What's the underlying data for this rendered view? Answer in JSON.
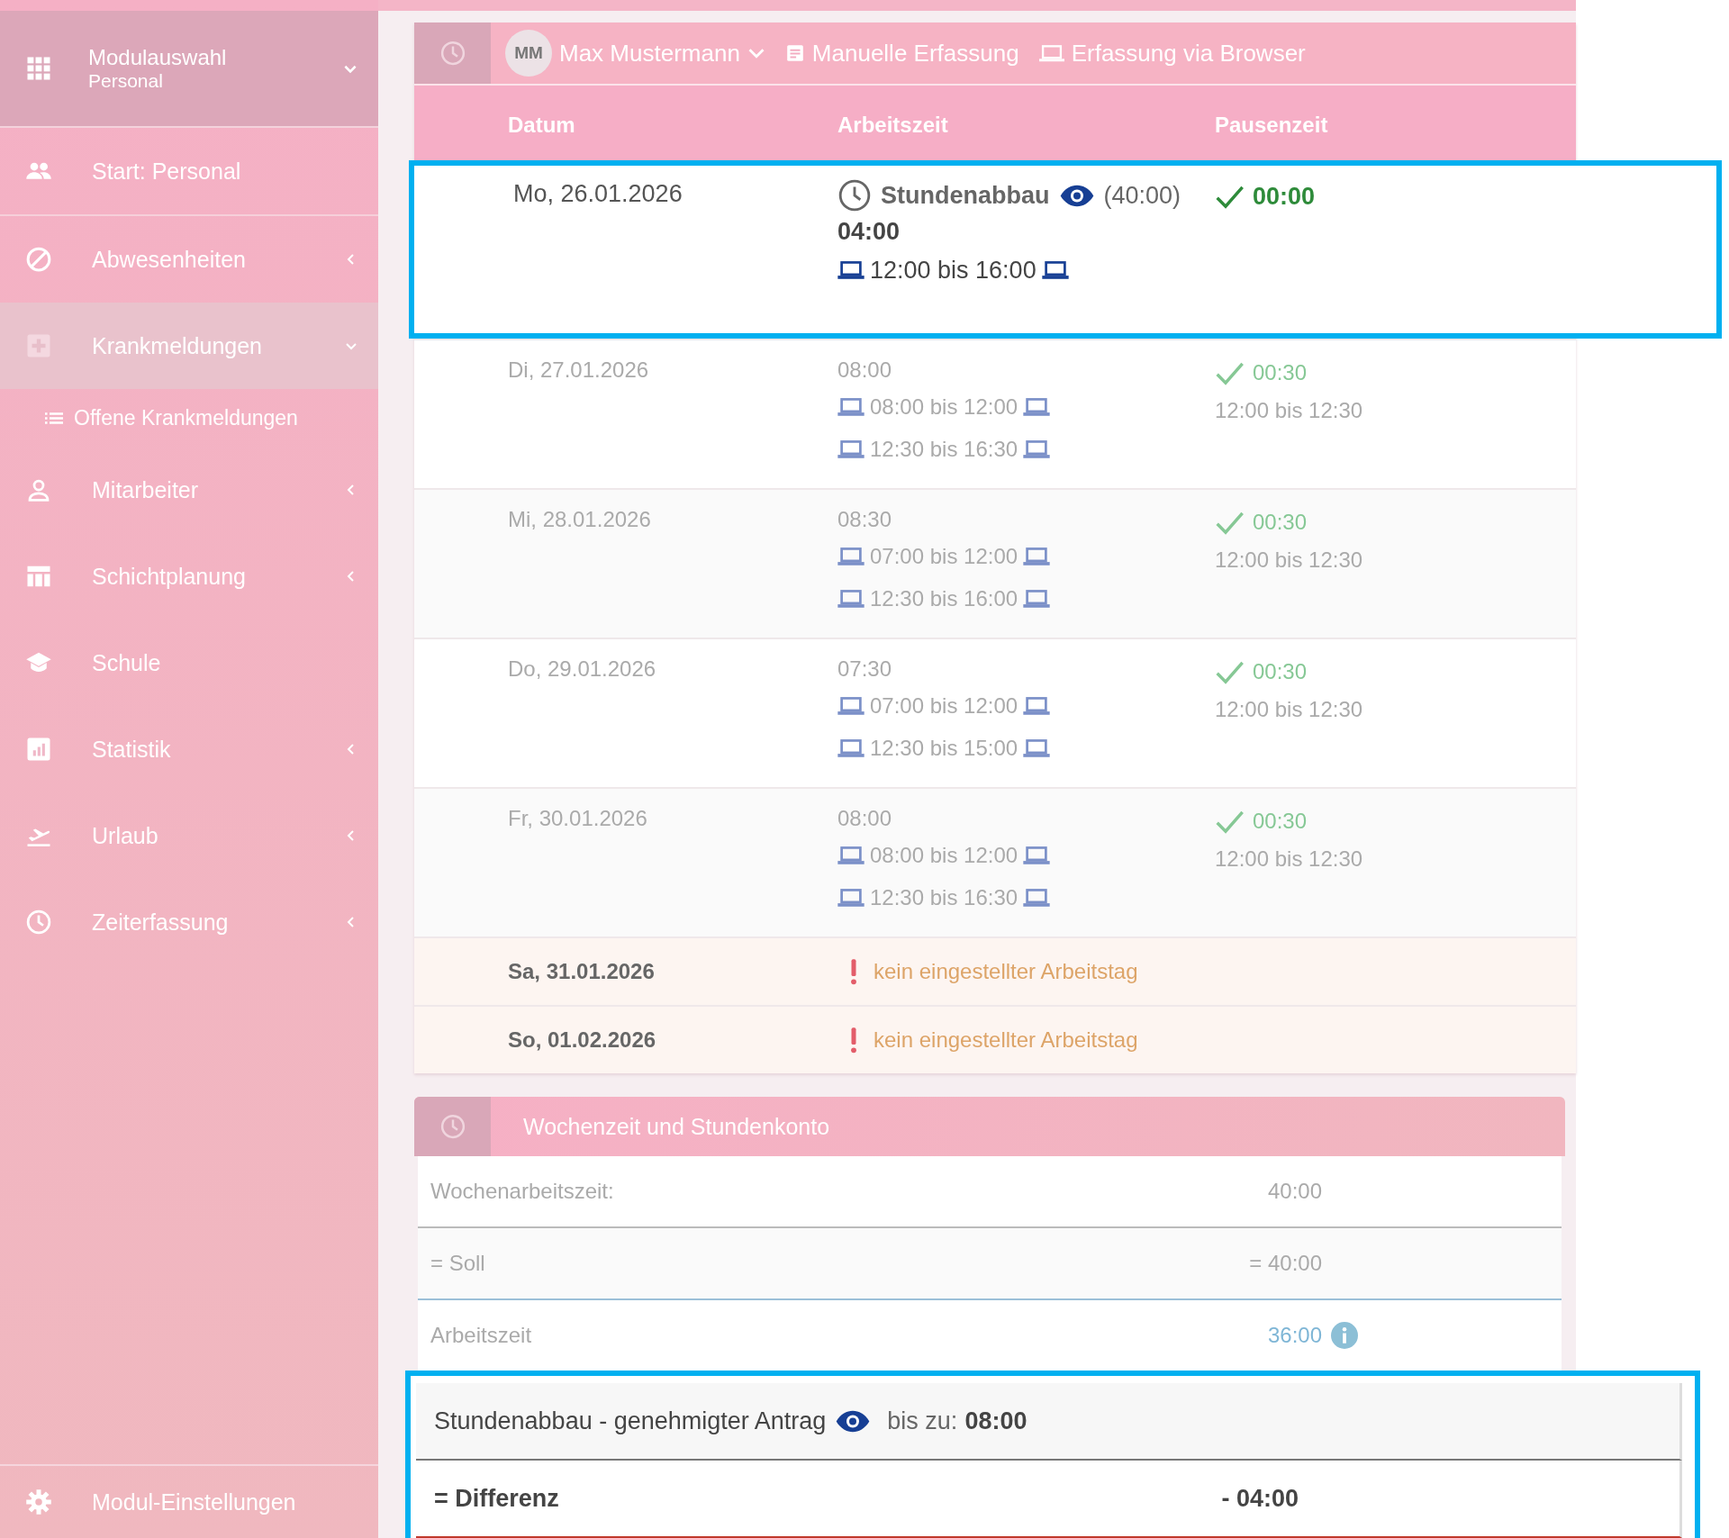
{
  "sidebar": {
    "module": {
      "title": "Modulauswahl",
      "subtitle": "Personal"
    },
    "items": [
      {
        "label": "Start: Personal",
        "kind": "link"
      },
      {
        "label": "Abwesenheiten",
        "kind": "group",
        "expanded": false
      },
      {
        "label": "Krankmeldungen",
        "kind": "group",
        "expanded": true,
        "children": [
          {
            "label": "Offene Krankmeldungen"
          }
        ]
      },
      {
        "label": "Mitarbeiter",
        "kind": "group",
        "expanded": false
      },
      {
        "label": "Schichtplanung",
        "kind": "group",
        "expanded": false
      },
      {
        "label": "Schule",
        "kind": "link"
      },
      {
        "label": "Statistik",
        "kind": "group",
        "expanded": false
      },
      {
        "label": "Urlaub",
        "kind": "group",
        "expanded": false
      },
      {
        "label": "Zeiterfassung",
        "kind": "group",
        "expanded": false
      }
    ],
    "footer": "Modul-Einstellungen"
  },
  "toolbar": {
    "user": {
      "initials": "MM",
      "name": "Max Mustermann"
    },
    "actions": [
      {
        "label": "Manuelle Erfassung",
        "kind": "form"
      },
      {
        "label": "Erfassung via Browser",
        "kind": "browser"
      }
    ]
  },
  "table": {
    "columns": [
      "Datum",
      "Arbeitszeit",
      "Pausenzeit"
    ],
    "rows": [
      {
        "kind": "work",
        "highlighted": true,
        "date": "Mo, 26.01.2026",
        "absence": {
          "label": "Stundenabbau",
          "hours": "(40:00)"
        },
        "total": "04:00",
        "entries": [
          "12:00 bis 16:00"
        ],
        "pause": "00:00",
        "pauses": []
      },
      {
        "kind": "work",
        "highlighted": false,
        "date": "Di, 27.01.2026",
        "total": "08:00",
        "entries": [
          "08:00 bis 12:00",
          "12:30 bis 16:30"
        ],
        "pause": "00:30",
        "pauses": [
          "12:00 bis 12:30"
        ]
      },
      {
        "kind": "work",
        "highlighted": false,
        "date": "Mi, 28.01.2026",
        "total": "08:30",
        "entries": [
          "07:00 bis 12:00",
          "12:30 bis 16:00"
        ],
        "pause": "00:30",
        "pauses": [
          "12:00 bis 12:30"
        ]
      },
      {
        "kind": "work",
        "highlighted": false,
        "date": "Do, 29.01.2026",
        "total": "07:30",
        "entries": [
          "07:00 bis 12:00",
          "12:30 bis 15:00"
        ],
        "pause": "00:30",
        "pauses": [
          "12:00 bis 12:30"
        ]
      },
      {
        "kind": "work",
        "highlighted": false,
        "date": "Fr, 30.01.2026",
        "total": "08:00",
        "entries": [
          "08:00 bis 12:00",
          "12:30 bis 16:30"
        ],
        "pause": "00:30",
        "pauses": [
          "12:00 bis 12:30"
        ]
      },
      {
        "kind": "off",
        "date": "Sa, 31.01.2026",
        "message": "kein eingestellter Arbeitstag"
      },
      {
        "kind": "off",
        "date": "So, 01.02.2026",
        "message": "kein eingestellter Arbeitstag"
      }
    ]
  },
  "summary": {
    "title": "Wochenzeit und Stundenkonto",
    "rows": [
      {
        "kind": "plain",
        "highlighted": false,
        "label": "Wochenarbeitszeit:",
        "value": "40:00"
      },
      {
        "kind": "plain",
        "highlighted": false,
        "label": "= Soll",
        "value": "= 40:00"
      },
      {
        "kind": "info",
        "highlighted": false,
        "label": "Arbeitszeit",
        "value": "36:00"
      },
      {
        "kind": "request",
        "highlighted": true,
        "label": "Stundenabbau - genehmigter Antrag",
        "note": "bis zu:",
        "value": "08:00"
      },
      {
        "kind": "total",
        "highlighted": true,
        "label": "= Differenz",
        "value": "- 04:00"
      }
    ]
  }
}
